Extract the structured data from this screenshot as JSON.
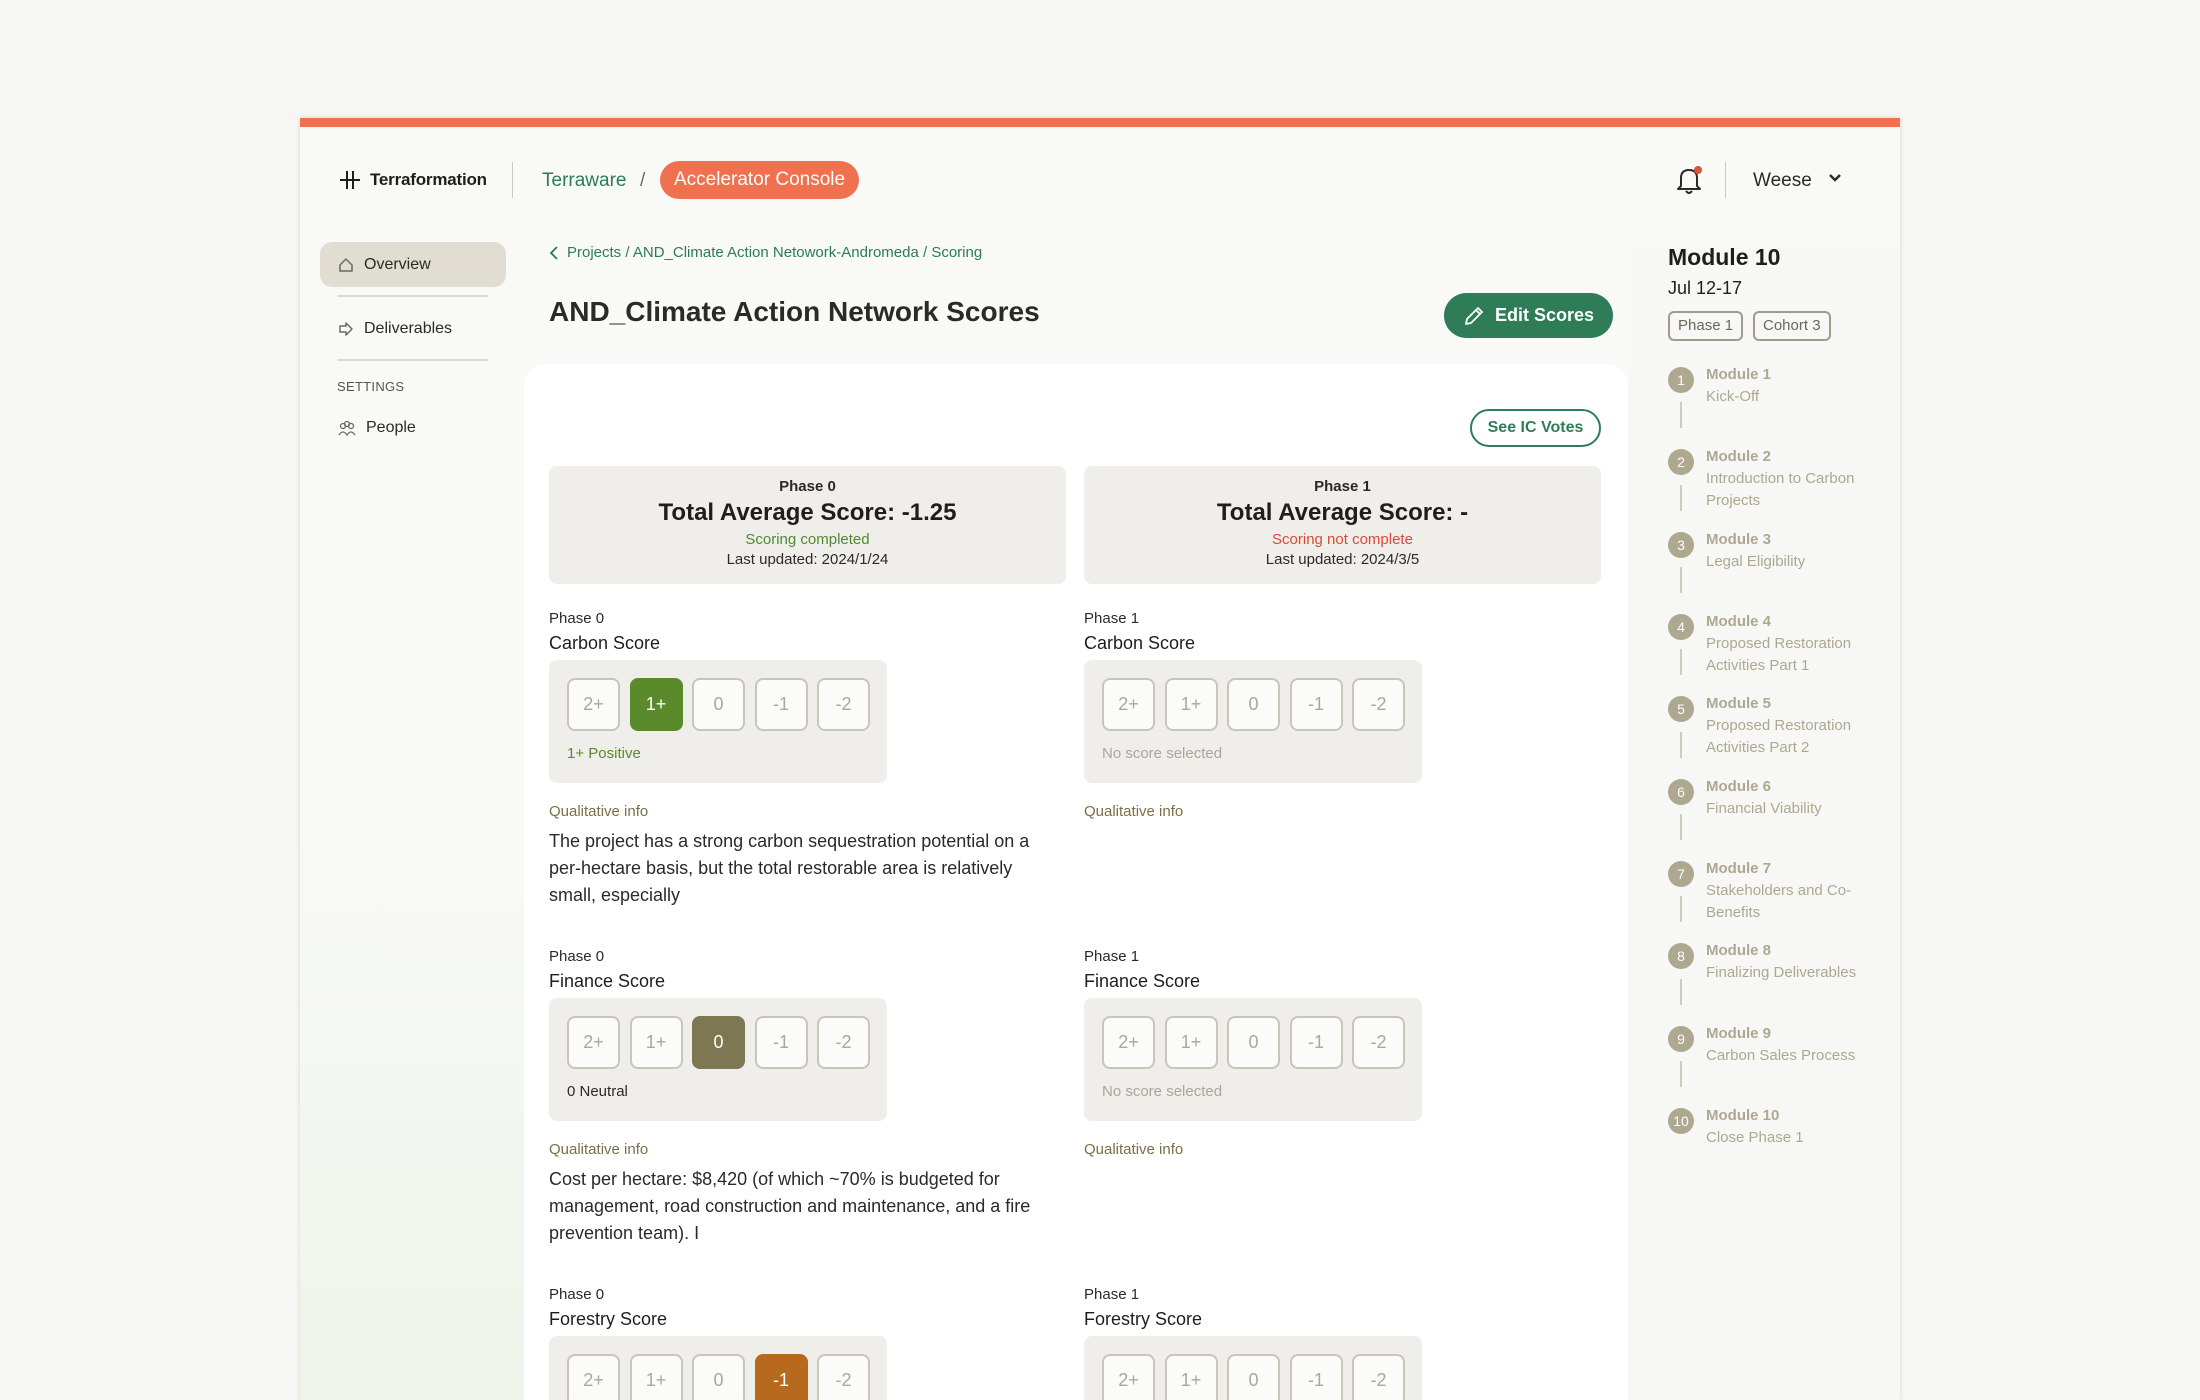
{
  "header": {
    "logo_text": "Terraformation",
    "nav_link": "Terraware",
    "nav_separator": "/",
    "console_label": "Accelerator Console",
    "user_name": "Weese",
    "notification_dot_color": "#e0533a"
  },
  "sidebar": {
    "items": [
      {
        "label": "Overview",
        "icon": "home-icon",
        "active": true
      },
      {
        "label": "Deliverables",
        "icon": "deliverables-icon",
        "active": false
      }
    ],
    "settings_heading": "SETTINGS",
    "settings_items": [
      {
        "label": "People",
        "icon": "people-icon"
      }
    ]
  },
  "main": {
    "breadcrumb": "Projects / AND_Climate Action Netowork-Andromeda / Scoring",
    "title": "AND_Climate Action Network Scores",
    "edit_button": "Edit Scores",
    "ic_votes_button": "See IC Votes",
    "summaries": [
      {
        "phase": "Phase 0",
        "total": "Total Average Score: -1.25",
        "status": "Scoring completed",
        "status_color": "#4f8a2e",
        "updated": "Last updated: 2024/1/24"
      },
      {
        "phase": "Phase 1",
        "total": "Total Average Score: -",
        "status": "Scoring not complete",
        "status_color": "#d94b34",
        "updated": "Last updated: 2024/3/5"
      }
    ],
    "score_options": [
      "2+",
      "1+",
      "0",
      "-1",
      "-2"
    ],
    "scores": [
      {
        "phase": "Phase 0",
        "name": "Carbon Score",
        "selected": "1+",
        "selected_color": "#5a8a2c",
        "result": "1+ Positive",
        "result_color": "#5a8a2c",
        "qual_heading": "Qualitative info",
        "qual_text": "The project has a strong carbon sequestration potential on a per-hectare basis, but the total restorable area is relatively small, especially"
      },
      {
        "phase": "Phase 1",
        "name": "Carbon Score",
        "selected": null,
        "result": "No score selected",
        "result_color": "#a9a69a",
        "qual_heading": "Qualitative info",
        "qual_text": ""
      },
      {
        "phase": "Phase 0",
        "name": "Finance Score",
        "selected": "0",
        "selected_color": "#7d7754",
        "result": "0 Neutral",
        "result_color": "#2a2a26",
        "qual_heading": "Qualitative info",
        "qual_text": "Cost per hectare: $8,420 (of which ~70% is budgeted for management, road construction and maintenance, and a fire prevention team). I"
      },
      {
        "phase": "Phase 1",
        "name": "Finance Score",
        "selected": null,
        "result": "No score selected",
        "result_color": "#a9a69a",
        "qual_heading": "Qualitative info",
        "qual_text": ""
      },
      {
        "phase": "Phase 0",
        "name": "Forestry Score",
        "selected": "-1",
        "selected_color": "#b76a1d",
        "result": "",
        "qual_heading": "",
        "qual_text": ""
      },
      {
        "phase": "Phase 1",
        "name": "Forestry Score",
        "selected": null,
        "result": "",
        "qual_heading": "",
        "qual_text": ""
      }
    ]
  },
  "module_panel": {
    "title": "Module 10",
    "date": "Jul 12-17",
    "tags": [
      "Phase 1",
      "Cohort 3"
    ],
    "steps": [
      {
        "num": "1",
        "title": "Module 1",
        "subtitle": "Kick-Off"
      },
      {
        "num": "2",
        "title": "Module 2",
        "subtitle": "Introduction to Carbon Projects"
      },
      {
        "num": "3",
        "title": "Module 3",
        "subtitle": "Legal Eligibility"
      },
      {
        "num": "4",
        "title": "Module 4",
        "subtitle": "Proposed Restoration Activities Part 1"
      },
      {
        "num": "5",
        "title": "Module 5",
        "subtitle": "Proposed Restoration Activities Part 2"
      },
      {
        "num": "6",
        "title": "Module 6",
        "subtitle": "Financial Viability"
      },
      {
        "num": "7",
        "title": "Module 7",
        "subtitle": "Stakeholders and Co-Benefits"
      },
      {
        "num": "8",
        "title": "Module 8",
        "subtitle": "Finalizing Deliverables"
      },
      {
        "num": "9",
        "title": "Module 9",
        "subtitle": "Carbon Sales Process"
      },
      {
        "num": "10",
        "title": "Module 10",
        "subtitle": "Close Phase 1"
      }
    ]
  }
}
